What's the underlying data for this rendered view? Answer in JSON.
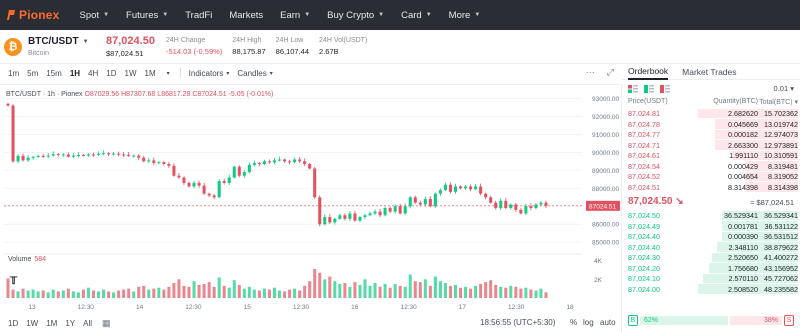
{
  "nav": {
    "logo": "Pionex",
    "items": [
      {
        "label": "Spot",
        "dropdown": true
      },
      {
        "label": "Futures",
        "dropdown": true
      },
      {
        "label": "TradFi",
        "dropdown": false
      },
      {
        "label": "Markets",
        "dropdown": false
      },
      {
        "label": "Earn",
        "dropdown": true
      },
      {
        "label": "Buy Crypto",
        "dropdown": true
      },
      {
        "label": "Card",
        "dropdown": true
      },
      {
        "label": "More",
        "dropdown": true
      }
    ]
  },
  "ticker": {
    "pair": "BTC/USDT",
    "coin_name": "Bitcoin",
    "last_price": "87,024.50",
    "last_price_usd": "$87,024.51",
    "stats": [
      {
        "label": "24H Change",
        "value": "-514.03 (-0.59%)",
        "down": true
      },
      {
        "label": "24H High",
        "value": "88,175.87",
        "down": false
      },
      {
        "label": "24H Low",
        "value": "86,107.44",
        "down": false
      },
      {
        "label": "24H Vol(USDT)",
        "value": "2.67B",
        "down": false
      }
    ]
  },
  "toolbar": {
    "timeframes": [
      "1m",
      "5m",
      "15m",
      "1H",
      "4H",
      "1D",
      "1W",
      "1M"
    ],
    "active_timeframe": "1H",
    "more_caret": "▾",
    "indicators_label": "Indicators",
    "candles_label": "Candles"
  },
  "chart_header": {
    "symbol": "BTC/USDT · 1h · Pionex",
    "open": "O87029.56",
    "high": "H87307.68",
    "low": "L86817.28",
    "close": "C87024.51",
    "change": "-5.05 (-0.01%)",
    "volume_label": "Volume",
    "volume_value": "584"
  },
  "chart_data": {
    "type": "candlestick",
    "price_axis_ticks": [
      "93000.00",
      "92000.00",
      "91000.00",
      "90000.00",
      "89000.00",
      "88000.00",
      "87000.00",
      "86000.00",
      "85000.00"
    ],
    "price_range": [
      84400,
      93300
    ],
    "current_price_label": "87024.51",
    "volume_axis_ticks": [
      "4K",
      "2K"
    ],
    "volume_range": [
      0,
      4600
    ],
    "time_axis_labels": [
      "13",
      "12:30",
      "14",
      "12:30",
      "15",
      "12:30",
      "16",
      "12:30",
      "17",
      "12:30",
      "18"
    ],
    "close_prices": [
      92600,
      89500,
      89800,
      89550,
      89700,
      89750,
      89800,
      89780,
      89820,
      89900,
      89850,
      89880,
      89760,
      89820,
      89850,
      89830,
      89880,
      89860,
      89920,
      89950,
      89900,
      89930,
      89880,
      89860,
      89800,
      89820,
      89700,
      89500,
      89550,
      89400,
      89450,
      89350,
      89250,
      88700,
      88600,
      88300,
      88100,
      88300,
      88150,
      87700,
      87600,
      87500,
      88400,
      88300,
      88600,
      89200,
      88700,
      88900,
      89300,
      89400,
      89350,
      89500,
      89450,
      89550,
      89600,
      89500,
      89450,
      89600,
      89500,
      89350,
      89100,
      87500,
      86000,
      86400,
      86100,
      86300,
      86500,
      86300,
      86600,
      86200,
      86400,
      86500,
      86600,
      86700,
      86500,
      86900,
      86700,
      87000,
      86600,
      87000,
      87500,
      87200,
      87100,
      87400,
      87000,
      87700,
      87900,
      88200,
      87800,
      88100,
      88000,
      88100,
      87950,
      88100,
      87700,
      87500,
      87200,
      86900,
      87300,
      86900,
      87100,
      86800,
      86600,
      87000,
      86900,
      87100,
      87200,
      87024.51
    ],
    "volumes": [
      2100,
      900,
      700,
      1000,
      800,
      900,
      700,
      800,
      600,
      900,
      700,
      800,
      1000,
      700,
      600,
      900,
      1100,
      800,
      700,
      900,
      700,
      600,
      800,
      900,
      1000,
      700,
      1200,
      1300,
      900,
      1000,
      1100,
      900,
      1200,
      1600,
      2000,
      1300,
      1200,
      1800,
      1400,
      1500,
      1700,
      1200,
      2200,
      1300,
      1100,
      1900,
      1400,
      1000,
      1200,
      900,
      800,
      1000,
      900,
      1100,
      800,
      700,
      900,
      1000,
      800,
      1300,
      1800,
      3100,
      2700,
      2000,
      2300,
      1800,
      1500,
      1600,
      1200,
      1700,
      1400,
      2000,
      1300,
      1600,
      1200,
      1500,
      1100,
      1500,
      1300,
      1200,
      2500,
      1800,
      1700,
      2000,
      1300,
      2300,
      1800,
      1600,
      1300,
      1400,
      1100,
      1200,
      1000,
      1300,
      1500,
      1700,
      1900,
      1400,
      1200,
      1100,
      1300,
      1200,
      1000,
      1100,
      900,
      800,
      1000,
      600
    ]
  },
  "chart_bottom": {
    "ranges": [
      "1D",
      "1W",
      "1M",
      "1Y",
      "All"
    ],
    "clock": "18:56:55 (UTC+5:30)",
    "percent": "%",
    "log": "log",
    "auto": "auto"
  },
  "orderbook": {
    "tabs": [
      "Orderbook",
      "Market Trades"
    ],
    "precision": "0.01 ▾",
    "headers": {
      "price": "Price(USDT)",
      "qty": "Quantity(BTC)",
      "total": "Total(BTC) ▾"
    },
    "asks": [
      {
        "price": "87,024.81",
        "qty": "2.682620",
        "total": "15.702362",
        "depth": 1.0
      },
      {
        "price": "87,024.78",
        "qty": "0.045669",
        "total": "13.019742",
        "depth": 0.83
      },
      {
        "price": "87,024.77",
        "qty": "0.000182",
        "total": "12.974073",
        "depth": 0.83
      },
      {
        "price": "87,024.71",
        "qty": "2.663300",
        "total": "12.973891",
        "depth": 0.83
      },
      {
        "price": "87,024.61",
        "qty": "1.991110",
        "total": "10.310591",
        "depth": 0.66
      },
      {
        "price": "87,024.54",
        "qty": "0.000429",
        "total": "8.319481",
        "depth": 0.53
      },
      {
        "price": "87,024.52",
        "qty": "0.004654",
        "total": "8.319052",
        "depth": 0.53
      },
      {
        "price": "87,024.51",
        "qty": "8.314398",
        "total": "8.314398",
        "depth": 0.53
      }
    ],
    "mid_price": "87,024.50 ↘",
    "mid_usd": "≈ $87,024.51",
    "bids": [
      {
        "price": "87,024.50",
        "qty": "36.529341",
        "total": "36.529341",
        "depth": 0.76
      },
      {
        "price": "87,024.49",
        "qty": "0.001781",
        "total": "36.531122",
        "depth": 0.76
      },
      {
        "price": "87,024.40",
        "qty": "0.000390",
        "total": "36.531512",
        "depth": 0.76
      },
      {
        "price": "87,024.40",
        "qty": "2.348110",
        "total": "38.879622",
        "depth": 0.81
      },
      {
        "price": "87,024.30",
        "qty": "2.520650",
        "total": "41.400272",
        "depth": 0.86
      },
      {
        "price": "87,024.20",
        "qty": "1.756680",
        "total": "43.156952",
        "depth": 0.89
      },
      {
        "price": "87,024.10",
        "qty": "2.570110",
        "total": "45.727062",
        "depth": 0.95
      },
      {
        "price": "87,024.00",
        "qty": "2.508520",
        "total": "48.235582",
        "depth": 1.0
      }
    ],
    "ratio": {
      "buy_tag": "B",
      "buy": "62%",
      "sell": "38%",
      "sell_tag": "S",
      "buy_fraction": 0.62
    }
  },
  "colors": {
    "up": "#0ecb81",
    "down": "#e05260",
    "brand": "#ff6a2c"
  }
}
